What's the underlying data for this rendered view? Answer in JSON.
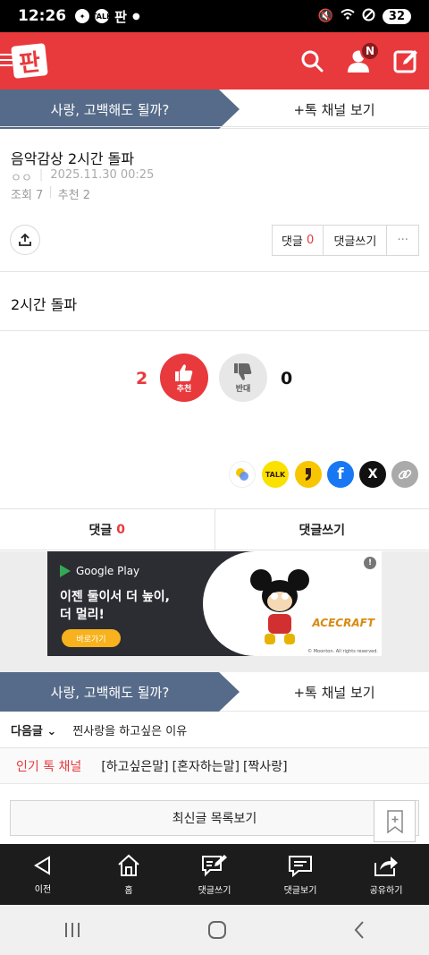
{
  "status": {
    "time": "12:26",
    "talk_label": "TALK",
    "pann_label": "판",
    "battery": "32"
  },
  "header": {
    "logo": "판",
    "notification_badge": "N"
  },
  "channel_banner": {
    "title": "사랑, 고백해도 될까?",
    "link": "+톡 채널 보기"
  },
  "post": {
    "title": "음악감상 2시간 돌파",
    "author": "ㅇㅇ",
    "date": "2025.11.30 00:25",
    "views": "조회 7",
    "recommend": "추천 2",
    "body": "2시간 돌파"
  },
  "comment_box": {
    "comment_label": "댓글",
    "comment_count": "0",
    "write_label": "댓글쓰기",
    "more": "···"
  },
  "votes": {
    "up_count": "2",
    "up_label": "추천",
    "down_label": "반대",
    "down_count": "0"
  },
  "sns": {
    "kakaotalk": "TALK",
    "facebook": "f",
    "x": "X"
  },
  "comment_tabs": {
    "comment_label": "댓글",
    "comment_count": "0",
    "write_label": "댓글쓰기"
  },
  "ad": {
    "store": "Google Play",
    "line1": "이젠 둘이서 더 높이,",
    "line2": "더 멀리!",
    "cta": "바로가기",
    "brand": "ACECRAFT",
    "copyright": "© Moonton. All rights reserved."
  },
  "channel_banner_2": {
    "title": "사랑, 고백해도 될까?",
    "link": "+톡 채널 보기"
  },
  "next_post": {
    "label": "다음글",
    "title": "찐사랑을 하고싶은 이유"
  },
  "popular": {
    "label": "인기 톡 채널",
    "tags": [
      "[하고싶은말]",
      "[혼자하는말]",
      "[짝사랑]"
    ]
  },
  "latest_button": "최신글 목록보기",
  "toolbar": [
    {
      "label": "이전",
      "icon": "back-triangle-icon"
    },
    {
      "label": "홈",
      "icon": "home-icon"
    },
    {
      "label": "댓글쓰기",
      "icon": "comment-write-icon"
    },
    {
      "label": "댓글보기",
      "icon": "comment-view-icon"
    },
    {
      "label": "공유하기",
      "icon": "share-icon"
    }
  ],
  "colors": {
    "brand_red": "#e8393d",
    "banner_blue": "#566b89",
    "toolbar_dark": "#1c1c1c"
  }
}
